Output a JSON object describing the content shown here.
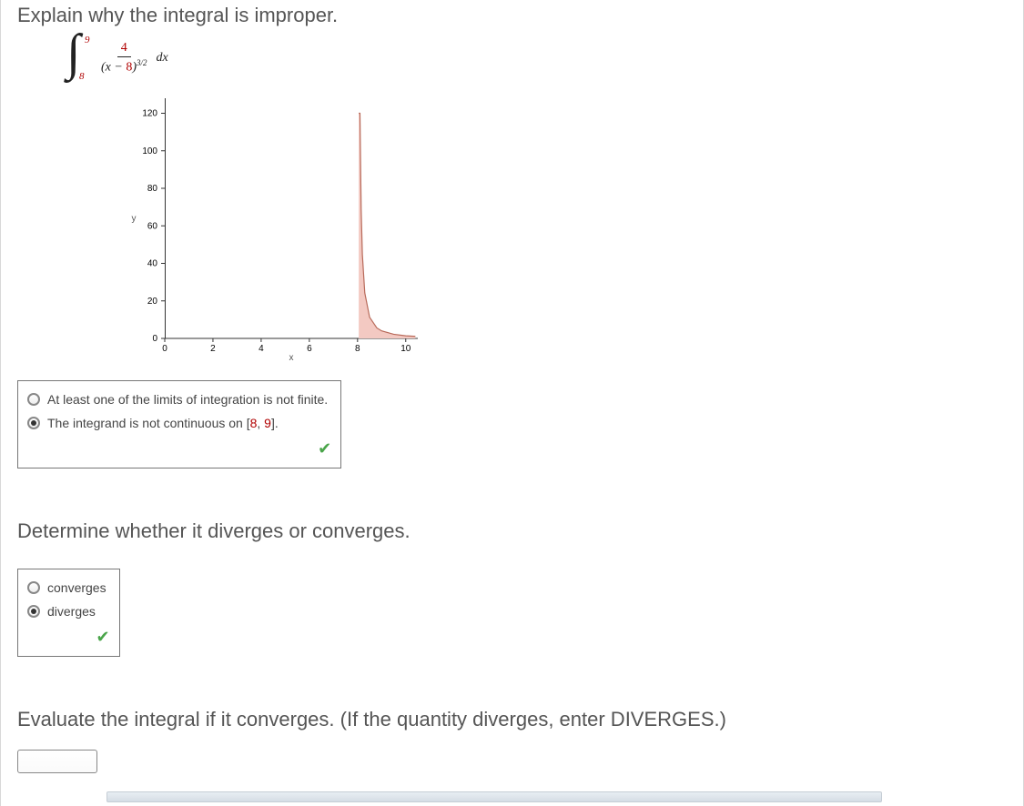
{
  "q1": {
    "prompt": "Explain why the integral is improper.",
    "integral": {
      "lower": "8",
      "upper": "9",
      "numerator": "4",
      "den_a": "8",
      "den_exp": "3/2"
    }
  },
  "chart_data": {
    "type": "area",
    "xlabel": "x",
    "ylabel": "y",
    "x_ticks": [
      0,
      2,
      4,
      6,
      8,
      10
    ],
    "y_ticks": [
      0,
      20,
      40,
      60,
      80,
      100,
      120
    ],
    "xlim": [
      0,
      10.5
    ],
    "ylim": [
      0,
      128
    ],
    "series": [
      {
        "name": "4/(x-8)^(3/2)",
        "x": [
          8.05,
          8.08,
          8.1,
          8.15,
          8.2,
          8.3,
          8.5,
          8.8,
          9.0,
          9.5,
          10.0,
          10.4
        ],
        "y": [
          120,
          120,
          120,
          68.8,
          44.7,
          24.3,
          11.3,
          5.6,
          4.0,
          2.2,
          1.4,
          1.1
        ]
      }
    ],
    "fill_color": "#f3c9c2",
    "stroke_color": "#b86a5a"
  },
  "options1": [
    {
      "label": "At least one of the limits of integration is not finite.",
      "selected": false
    },
    {
      "label_pre": "The integrand is not continuous on [",
      "n1": "8",
      "sep": ", ",
      "n2": "9",
      "label_post": "].",
      "selected": true
    }
  ],
  "q2": {
    "prompt": "Determine whether it diverges or converges."
  },
  "options2": [
    {
      "label": "converges",
      "selected": false
    },
    {
      "label": "diverges",
      "selected": true
    }
  ],
  "q3": {
    "prompt": "Evaluate the integral if it converges. (If the quantity diverges, enter DIVERGES.)"
  },
  "check_glyph": "✔"
}
